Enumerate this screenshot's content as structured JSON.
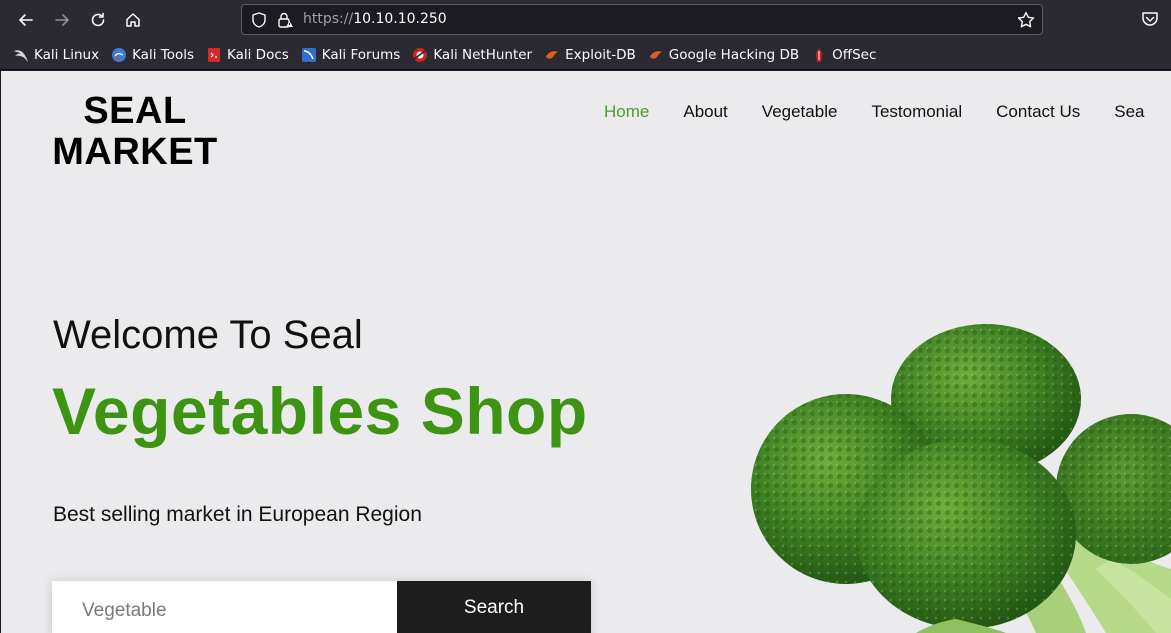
{
  "browser": {
    "url_protocol": "https://",
    "url_host": "10.10.10.250",
    "icons": {
      "back": "back-arrow-icon",
      "forward": "forward-arrow-icon",
      "reload": "reload-icon",
      "home": "home-icon",
      "shield": "tracking-shield-icon",
      "lock": "lock-warning-icon",
      "star": "bookmark-star-icon",
      "pocket": "pocket-icon"
    }
  },
  "bookmarks": [
    {
      "label": "Kali Linux",
      "icon": "kali-dragon-icon",
      "color": "#111111"
    },
    {
      "label": "Kali Tools",
      "icon": "kali-tools-icon",
      "color": "#3b7dd8"
    },
    {
      "label": "Kali Docs",
      "icon": "kali-docs-icon",
      "color": "#d42a2a"
    },
    {
      "label": "Kali Forums",
      "icon": "kali-forums-icon",
      "color": "#2f6fd0"
    },
    {
      "label": "Kali NetHunter",
      "icon": "nethunter-icon",
      "color": "#cc2222"
    },
    {
      "label": "Exploit-DB",
      "icon": "exploit-db-icon",
      "color": "#e0601c"
    },
    {
      "label": "Google Hacking DB",
      "icon": "ghdb-icon",
      "color": "#e0601c"
    },
    {
      "label": "OffSec",
      "icon": "offsec-icon",
      "color": "#c81e1e"
    }
  ],
  "site": {
    "logo_line1": "SEAL",
    "logo_line2": "MARKET",
    "nav": [
      {
        "label": "Home",
        "active": true
      },
      {
        "label": "About",
        "active": false
      },
      {
        "label": "Vegetable",
        "active": false
      },
      {
        "label": "Testomonial",
        "active": false
      },
      {
        "label": "Contact Us",
        "active": false
      },
      {
        "label": "Sea",
        "active": false
      }
    ],
    "welcome": "Welcome To Seal",
    "headline": "Vegetables Shop",
    "tagline": "Best selling market in European Region",
    "search": {
      "placeholder": "Vegetable",
      "button_label": "Search"
    },
    "hero_image": "broccoli-image",
    "accent_color": "#3d9412"
  }
}
